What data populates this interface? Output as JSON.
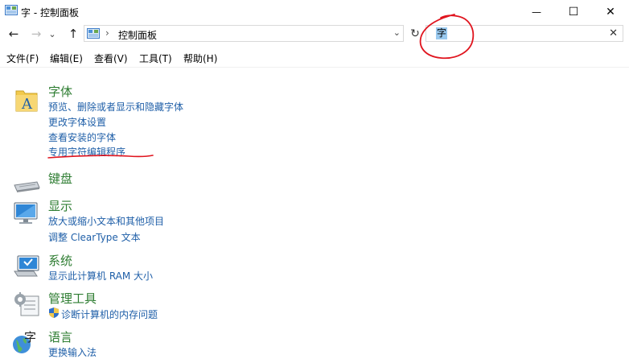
{
  "window": {
    "title": "字 - 控制面板",
    "minimize_glyph": "—",
    "maximize_glyph": "☐",
    "close_glyph": "✕"
  },
  "nav": {
    "back_glyph": "←",
    "forward_glyph": "→",
    "recent_glyph": "⌄",
    "up_glyph": "↑",
    "address_separator": "›",
    "address_path": "控制面板",
    "address_dropdown_glyph": "⌄",
    "refresh_glyph": "↻"
  },
  "search": {
    "value": "字",
    "clear_glyph": "✕"
  },
  "menu": [
    "文件(F)",
    "编辑(E)",
    "查看(V)",
    "工具(T)",
    "帮助(H)"
  ],
  "categories": [
    {
      "title": "字体",
      "icon": "fonts-folder-icon",
      "links": [
        "预览、删除或者显示和隐藏字体",
        "更改字体设置",
        "查看安装的字体",
        "专用字符编辑程序"
      ]
    },
    {
      "title": "键盘",
      "icon": "keyboard-icon",
      "links": []
    },
    {
      "title": "显示",
      "icon": "display-monitor-icon",
      "links": [
        "放大或缩小文本和其他项目",
        "调整 ClearType 文本"
      ]
    },
    {
      "title": "系统",
      "icon": "system-computer-icon",
      "links": [
        "显示此计算机 RAM 大小"
      ]
    },
    {
      "title": "管理工具",
      "icon": "admin-tools-icon",
      "links": [
        "诊断计算机的内存问题"
      ]
    },
    {
      "title": "语言",
      "icon": "language-globe-icon",
      "links": [
        "更换输入法"
      ]
    }
  ],
  "colors": {
    "category_title": "#2e7d32",
    "link": "#1f5fa8",
    "annotation": "#e0141e",
    "search_selection": "#99c9ef"
  }
}
